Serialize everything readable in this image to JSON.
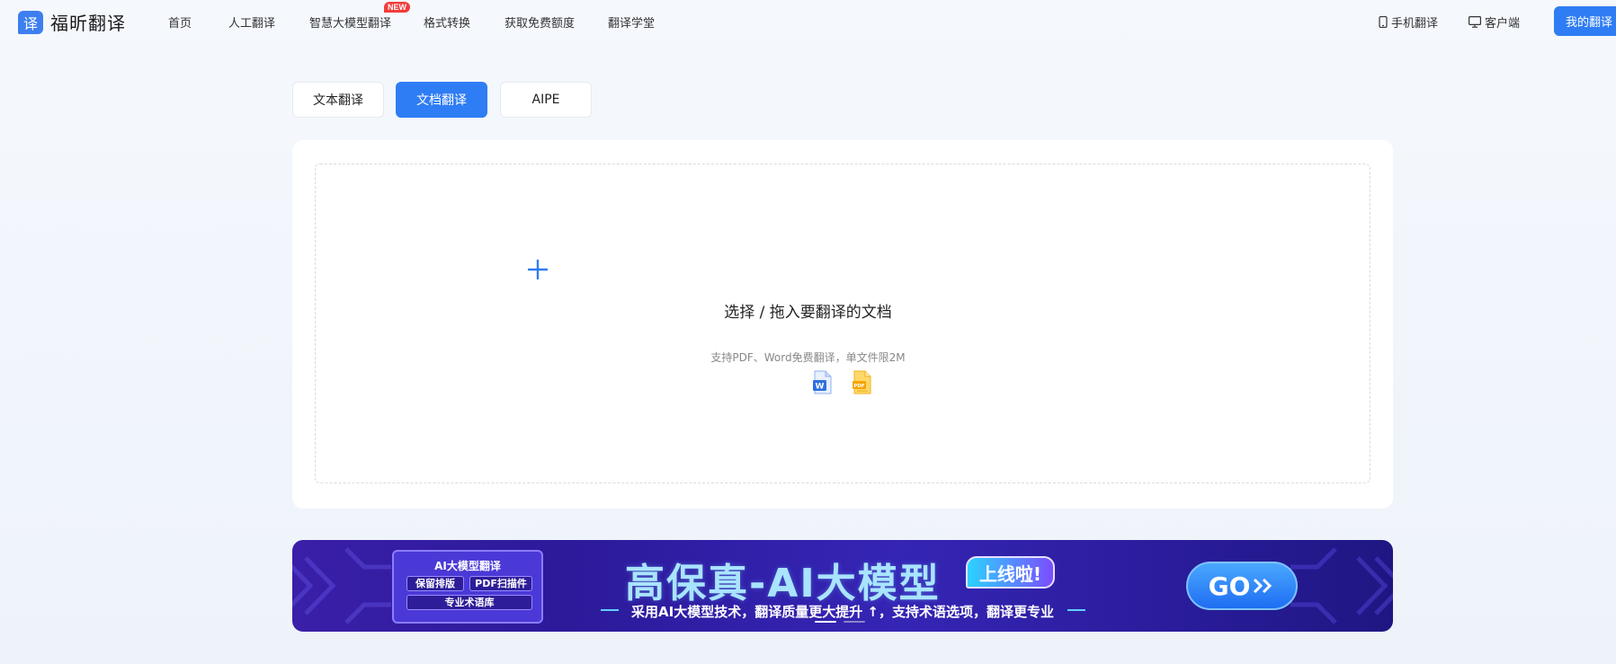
{
  "brand": {
    "logo_glyph": "译",
    "name": "福昕翻译",
    "accent": "#2f7df4"
  },
  "nav": {
    "items": [
      {
        "label": "首页"
      },
      {
        "label": "人工翻译"
      },
      {
        "label": "智慧大模型翻译",
        "badge": "NEW"
      },
      {
        "label": "格式转换"
      },
      {
        "label": "获取免费额度"
      },
      {
        "label": "翻译学堂"
      }
    ],
    "mobile": "手机翻译",
    "client": "客户端",
    "account": "我的翻译"
  },
  "tabs": [
    {
      "label": "文本翻译",
      "active": false
    },
    {
      "label": "文档翻译",
      "active": true
    },
    {
      "label": "AIPE",
      "active": false
    }
  ],
  "upload": {
    "title": "选择 / 拖入要翻译的文档",
    "hint": "支持PDF、Word免费翻译，单文件限2M",
    "file_types": [
      {
        "icon": "word-file-icon",
        "label": "W"
      },
      {
        "icon": "pdf-file-icon",
        "label": "PDF"
      }
    ]
  },
  "banner": {
    "box_title": "AI大模型翻译",
    "box_tags": [
      "保留排版",
      "PDF扫描件",
      "专业术语库"
    ],
    "headline": "高保真-AI大模型",
    "badge": "上线啦!",
    "subline": "采用AI大模型技术，翻译质量更大提升 ↑，支持术语选项，翻译更专业",
    "cta": "GO",
    "slides": 2,
    "active_slide": 1
  }
}
